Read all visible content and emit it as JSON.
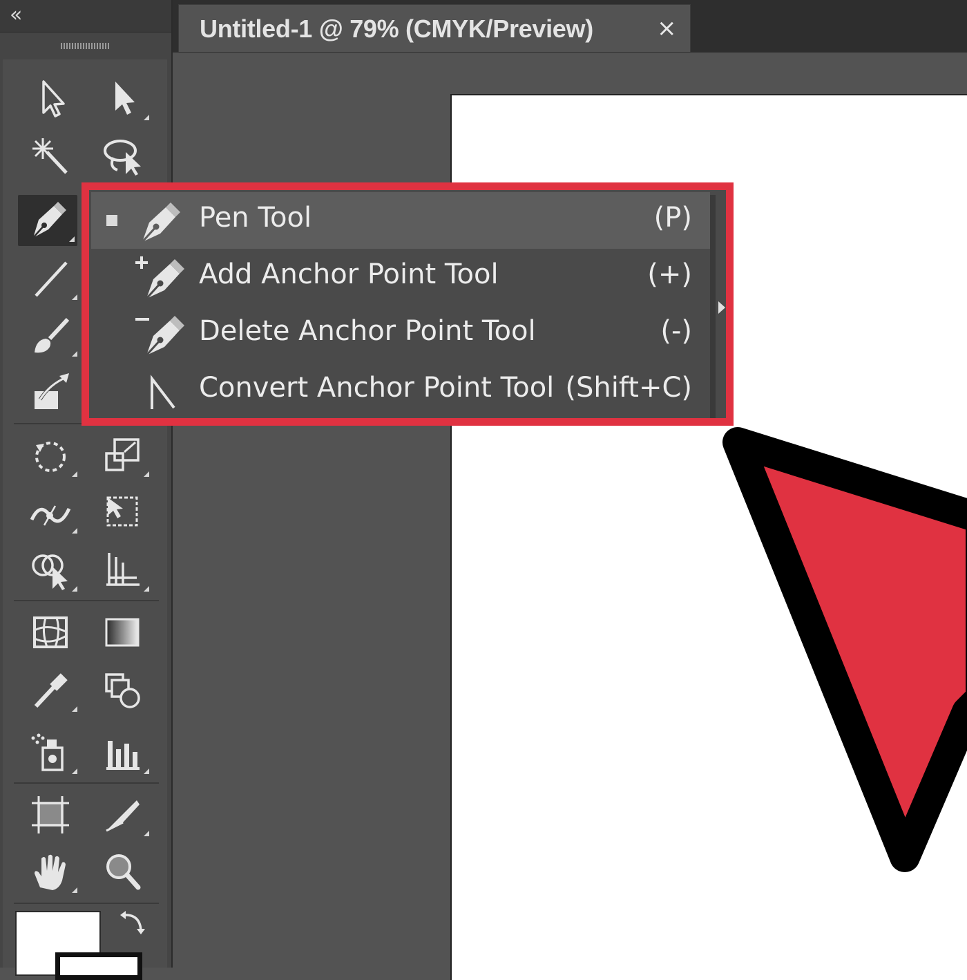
{
  "document_tab": {
    "title": "Untitled-1 @ 79% (CMYK/Preview)",
    "close_glyph": "×"
  },
  "toolbar": {
    "collapse_glyph": "«",
    "tools": [
      {
        "name": "selection-tool",
        "icon": "arrow-icon"
      },
      {
        "name": "direct-selection-tool",
        "icon": "white-arrow-icon"
      },
      {
        "name": "magic-wand-tool",
        "icon": "magic-wand-icon"
      },
      {
        "name": "lasso-tool",
        "icon": "lasso-icon"
      },
      {
        "name": "pen-tool",
        "icon": "pen-icon",
        "active": true
      },
      {
        "name": "line-segment-tool",
        "icon": "line-icon"
      },
      {
        "name": "paintbrush-tool",
        "icon": "brush-icon"
      },
      {
        "name": "shaper-tool",
        "icon": "shaper-icon"
      },
      {
        "name": "rotate-tool",
        "icon": "rotate-icon"
      },
      {
        "name": "scale-tool",
        "icon": "scale-icon"
      },
      {
        "name": "width-tool",
        "icon": "width-icon"
      },
      {
        "name": "free-transform-tool",
        "icon": "free-transform-icon"
      },
      {
        "name": "shape-builder-tool",
        "icon": "shape-builder-icon"
      },
      {
        "name": "perspective-grid-tool",
        "icon": "perspective-grid-icon"
      },
      {
        "name": "mesh-tool",
        "icon": "mesh-icon"
      },
      {
        "name": "gradient-tool",
        "icon": "gradient-icon"
      },
      {
        "name": "eyedropper-tool",
        "icon": "eyedropper-icon"
      },
      {
        "name": "blend-tool",
        "icon": "blend-icon"
      },
      {
        "name": "symbol-sprayer-tool",
        "icon": "symbol-sprayer-icon"
      },
      {
        "name": "column-graph-tool",
        "icon": "column-graph-icon"
      },
      {
        "name": "artboard-tool",
        "icon": "artboard-icon"
      },
      {
        "name": "slice-tool",
        "icon": "slice-icon"
      },
      {
        "name": "hand-tool",
        "icon": "hand-icon"
      },
      {
        "name": "zoom-tool",
        "icon": "zoom-icon"
      }
    ],
    "fill_color": "#ffffff",
    "stroke_color": "#111111"
  },
  "pen_flyout": {
    "items": [
      {
        "label": "Pen Tool",
        "shortcut": "(P)",
        "icon": "pen-icon",
        "selected": true
      },
      {
        "label": "Add Anchor Point Tool",
        "shortcut": "(+)",
        "icon": "add-anchor-point-icon",
        "selected": false
      },
      {
        "label": "Delete Anchor Point Tool",
        "shortcut": "(-)",
        "icon": "delete-anchor-point-icon",
        "selected": false
      },
      {
        "label": "Convert Anchor Point Tool",
        "shortcut": "(Shift+C)",
        "icon": "convert-anchor-point-icon",
        "selected": false
      }
    ]
  },
  "colors": {
    "highlight": "#e03241",
    "panel": "#454545",
    "canvas": "#535353",
    "artboard": "#ffffff",
    "pointer_fill": "#e03241",
    "pointer_outline": "#000000"
  }
}
